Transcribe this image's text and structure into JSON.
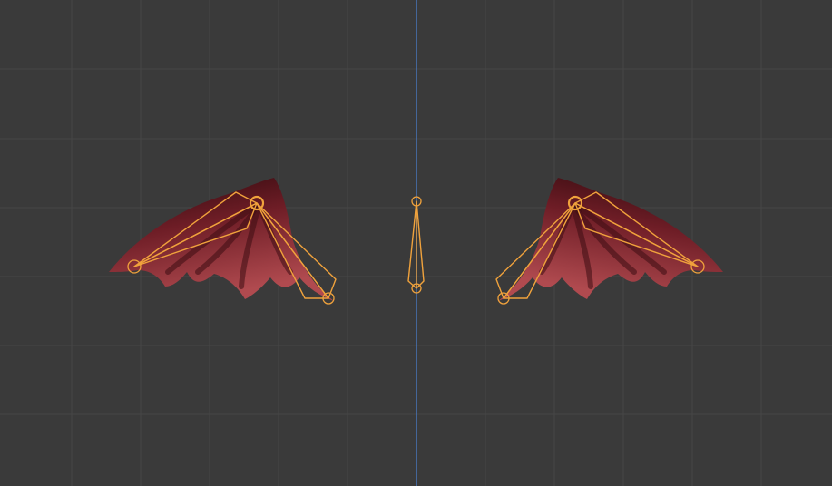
{
  "viewport": {
    "mode": "armature-edit",
    "background_color": "#3a3a3a",
    "grid_color": "#464646",
    "axis_color": "#4a79c2"
  },
  "colors": {
    "bone_outline": "#f0a23c",
    "wing_highlight": "#b04a4f",
    "wing_mid": "#7a222b",
    "wing_shadow": "#2a070b"
  },
  "objects": [
    {
      "name": "left-wing-mesh",
      "kind": "mesh"
    },
    {
      "name": "right-wing-mesh",
      "kind": "mesh"
    },
    {
      "name": "center-spine-bone",
      "kind": "bone"
    }
  ]
}
